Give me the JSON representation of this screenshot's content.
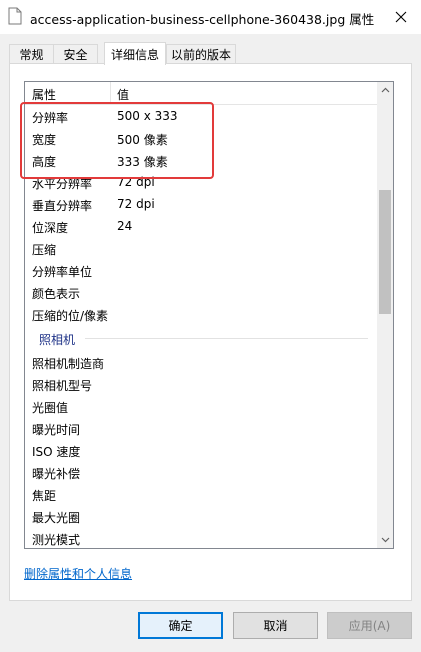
{
  "window": {
    "title": "access-application-business-cellphone-360438.jpg 属性"
  },
  "tabs": [
    {
      "label": "常规",
      "active": false
    },
    {
      "label": "安全",
      "active": false
    },
    {
      "label": "详细信息",
      "active": true
    },
    {
      "label": "以前的版本",
      "active": false
    }
  ],
  "list": {
    "header": {
      "property": "属性",
      "value": "值"
    },
    "rows": [
      {
        "key": "分辨率",
        "value": "500 x 333"
      },
      {
        "key": "宽度",
        "value": "500 像素"
      },
      {
        "key": "高度",
        "value": "333 像素"
      },
      {
        "key": "水平分辨率",
        "value": "72 dpi"
      },
      {
        "key": "垂直分辨率",
        "value": "72 dpi"
      },
      {
        "key": "位深度",
        "value": "24"
      },
      {
        "key": "压缩",
        "value": ""
      },
      {
        "key": "分辨率单位",
        "value": ""
      },
      {
        "key": "颜色表示",
        "value": ""
      },
      {
        "key": "压缩的位/像素",
        "value": ""
      }
    ],
    "group": {
      "label": "照相机"
    },
    "camera_rows": [
      {
        "key": "照相机制造商",
        "value": ""
      },
      {
        "key": "照相机型号",
        "value": ""
      },
      {
        "key": "光圈值",
        "value": ""
      },
      {
        "key": "曝光时间",
        "value": ""
      },
      {
        "key": "ISO 速度",
        "value": ""
      },
      {
        "key": "曝光补偿",
        "value": ""
      },
      {
        "key": "焦距",
        "value": ""
      },
      {
        "key": "最大光圈",
        "value": ""
      },
      {
        "key": "测光模式",
        "value": ""
      }
    ]
  },
  "link": {
    "label": "删除属性和个人信息"
  },
  "buttons": {
    "ok": "确定",
    "cancel": "取消",
    "apply": "应用(A)"
  },
  "colors": {
    "accent": "#0078d7",
    "highlight": "#e23a3a",
    "link": "#0066cc"
  }
}
